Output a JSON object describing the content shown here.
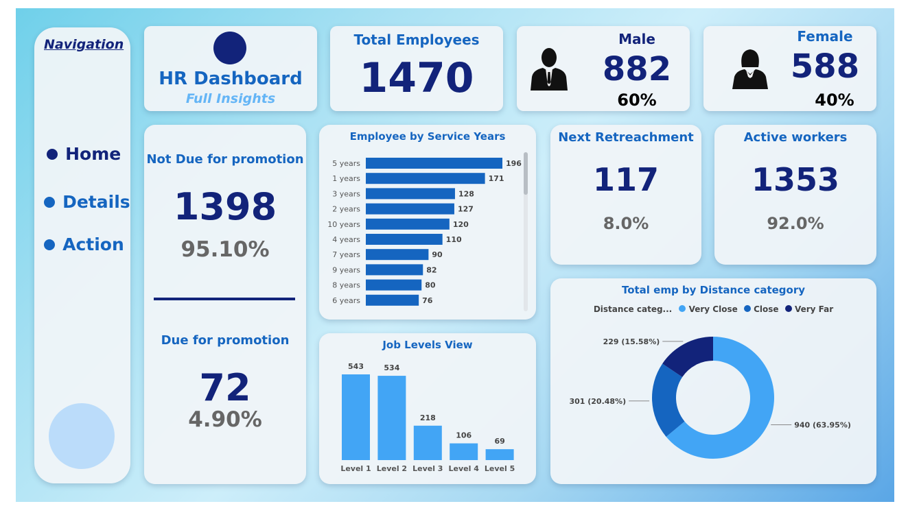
{
  "navigation": {
    "title": "Navigation",
    "items": [
      {
        "label": "Home"
      },
      {
        "label": "Details"
      },
      {
        "label": "Action"
      }
    ]
  },
  "header": {
    "title": "HR Dashboard",
    "subtitle": "Full Insights"
  },
  "kpis": {
    "total": {
      "label": "Total Employees",
      "value": "1470"
    },
    "male": {
      "label": "Male",
      "value": "882",
      "pct": "60%"
    },
    "female": {
      "label": "Female",
      "value": "588",
      "pct": "40%"
    },
    "next_retreachment": {
      "label": "Next Retreachment",
      "value": "117",
      "pct": "8.0%"
    },
    "active_workers": {
      "label": "Active workers",
      "value": "1353",
      "pct": "92.0%"
    },
    "not_due": {
      "label": "Not Due for promotion",
      "value": "1398",
      "pct": "95.10%"
    },
    "due": {
      "label": "Due for promotion",
      "value": "72",
      "pct": "4.90%"
    }
  },
  "colors": {
    "accent": "#1565c0",
    "navy": "#12237a",
    "bar_dark": "#1565c0",
    "bar_light": "#42a5f5",
    "very_close": "#42a5f5",
    "close": "#1565c0",
    "very_far": "#12237a"
  },
  "icons": {
    "male": "male-person-icon",
    "female": "female-person-icon"
  },
  "chart_data": [
    {
      "type": "bar",
      "orientation": "horizontal",
      "title": "Employee by Service Years",
      "categories": [
        "5 years",
        "1 years",
        "3 years",
        "2 years",
        "10 years",
        "4 years",
        "7 years",
        "9 years",
        "8 years",
        "6 years"
      ],
      "values": [
        196,
        171,
        128,
        127,
        120,
        110,
        90,
        82,
        80,
        76
      ],
      "xlabel": "",
      "ylabel": ""
    },
    {
      "type": "bar",
      "title": "Job Levels View",
      "categories": [
        "Level 1",
        "Level 2",
        "Level 3",
        "Level 4",
        "Level 5"
      ],
      "values": [
        543,
        534,
        218,
        106,
        69
      ],
      "xlabel": "",
      "ylabel": ""
    },
    {
      "type": "pie",
      "donut": true,
      "title": "Total emp by Distance category",
      "legend_title": "Distance categ...",
      "legend_position": "top",
      "series": [
        {
          "name": "Very Close",
          "value": 940,
          "label": "940 (63.95%)"
        },
        {
          "name": "Close",
          "value": 301,
          "label": "301 (20.48%)"
        },
        {
          "name": "Very Far",
          "value": 229,
          "label": "229 (15.58%)"
        }
      ]
    }
  ]
}
